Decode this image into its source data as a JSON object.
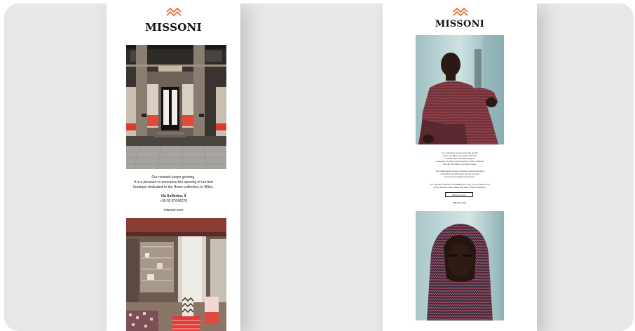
{
  "left_email": {
    "brand": "MISSONI",
    "copy": {
      "line1": "Our network keeps growing.",
      "line2": "It is a pleasure to announce the opening of our first",
      "line3": "boutique dedicated to the Home collection, in Milan.",
      "address": "Via Solferino, 9",
      "phone": "+39 02 87046276",
      "website": "missoni.com"
    }
  },
  "right_email": {
    "brand": "MISSONI",
    "copy": {
      "p1_l1": "It is a pleasure to announce the launch",
      "p1_l2": "of the new Missoni capsule collection",
      "p1_l3": "in collaboration with Eric Bergère,",
      "p1_l4": "a selection of pieces that reveal the world of Missoni",
      "p1_l5": "through the brand's symbolic codes.",
      "p2_l1": "The collaboration between Missoni and Eric Bergère",
      "p2_l2": "celebrates two distinctive visions for knits",
      "p2_l3": "such as personality and passion.",
      "p3_l1": "The Capsule Collection is available from July 7th on missoni.com",
      "p3_l2": "and in Missoni, Paris, Milan and Saint Tropez boutiques.",
      "button_label": "Discover more",
      "website": "Missoni.com"
    }
  },
  "colors": {
    "canvas_bg": "#e6e7e9",
    "logo_orange": "#e5703a",
    "text": "#222222"
  }
}
